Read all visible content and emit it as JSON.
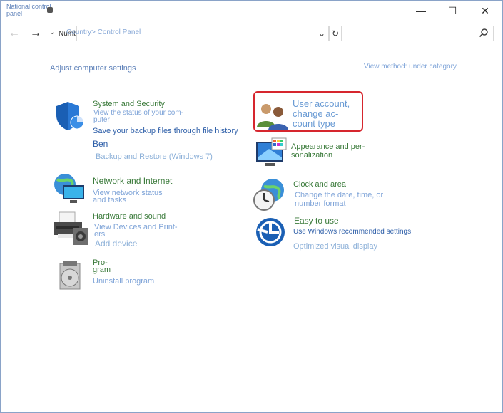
{
  "window": {
    "title_line1": "National control",
    "title_line2": "panel"
  },
  "window_controls": {
    "minimize": "—",
    "maximize": "☐",
    "close": "✕"
  },
  "address_bar": {
    "recent_label": "Number",
    "path": "Country> Control Panel",
    "search_placeholder": ""
  },
  "header": {
    "adjust_label": "Adjust computer settings",
    "view_by": "View method: under category"
  },
  "categories": {
    "system_security": {
      "title": "System and Security",
      "link1_line1": "View the status of your com-",
      "link1_line2": "puter",
      "link2": "Save your backup files through file history",
      "link3": "Ben",
      "link4": "Backup and Restore (Windows 7)"
    },
    "network": {
      "title": "Network and Internet",
      "link1_line1": "View network status",
      "link1_line2": "and tasks"
    },
    "hardware": {
      "title": "Hardware and sound",
      "link1_line1": "View Devices and Print-",
      "link1_line2": "ers",
      "link2": "Add device"
    },
    "programs": {
      "title_line1": "Pro-",
      "title_line2": "gram",
      "link1": "Uninstall program"
    },
    "user_accounts": {
      "title_line1": "User account,",
      "title_line2": "change ac-",
      "title_line3": "count type"
    },
    "appearance": {
      "title_line1": "Appearance and per-",
      "title_line2": "sonalization"
    },
    "clock": {
      "title": "Clock and area",
      "link1_line1": "Change the date, time, or",
      "link1_line2": "number format"
    },
    "ease": {
      "title": "Easy to use",
      "link1": "Use Windows recommended settings",
      "link2": "Optimized visual display"
    }
  },
  "colors": {
    "highlight": "#d6262e",
    "link": "#7fa4d8",
    "category_title": "#3a7a3a"
  }
}
